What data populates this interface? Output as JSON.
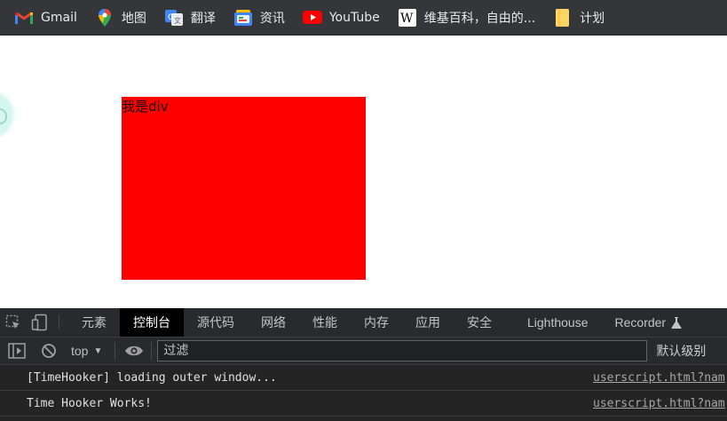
{
  "bookmarks": [
    {
      "label": "Gmail",
      "icon": "gmail-icon"
    },
    {
      "label": "地图",
      "icon": "maps-icon"
    },
    {
      "label": "翻译",
      "icon": "translate-icon"
    },
    {
      "label": "资讯",
      "icon": "news-icon"
    },
    {
      "label": "YouTube",
      "icon": "youtube-icon"
    },
    {
      "label": "维基百科，自由的...",
      "icon": "wikipedia-icon"
    },
    {
      "label": "计划",
      "icon": "folder-icon"
    }
  ],
  "page": {
    "div_text": "我是div",
    "div_color": "#ff0000"
  },
  "devtools": {
    "tabs": [
      "元素",
      "控制台",
      "源代码",
      "网络",
      "性能",
      "内存",
      "应用",
      "安全",
      "Lighthouse",
      "Recorder"
    ],
    "active_tab": "控制台",
    "context": "top",
    "filter_placeholder": "过滤",
    "levels_label": "默认级别",
    "console": [
      {
        "message": "[TimeHooker] loading outer window...",
        "source": "userscript.html?nam"
      },
      {
        "message": "Time Hooker Works!",
        "source": "userscript.html?nam"
      }
    ]
  }
}
